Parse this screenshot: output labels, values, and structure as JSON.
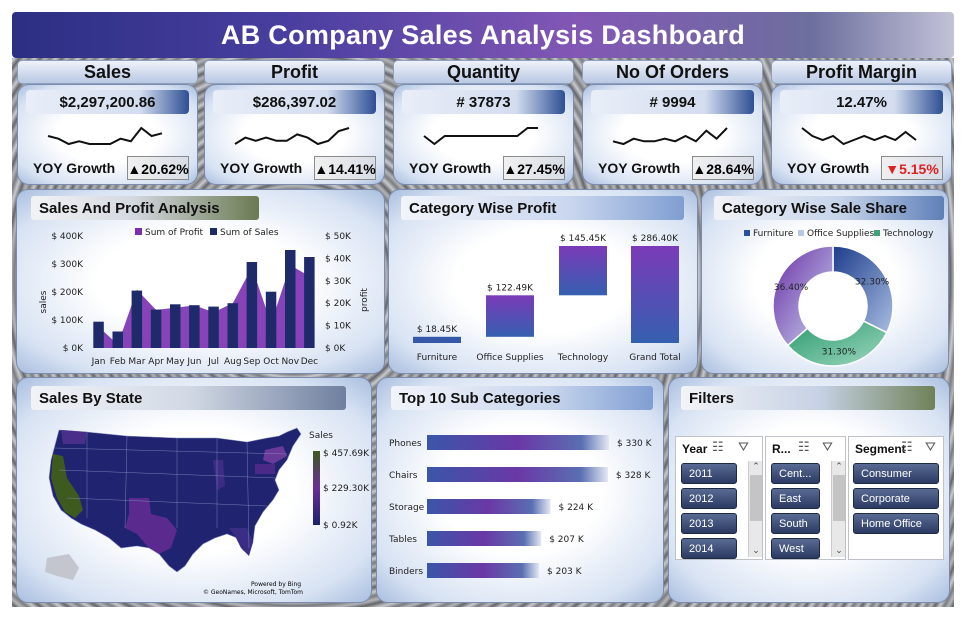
{
  "title": "AB Company Sales Analysis Dashboard",
  "kpis": [
    {
      "label": "Sales",
      "value": "$2,297,200.86",
      "yoy_label": "YOY Growth",
      "yoy": "20.62%",
      "trend": "up",
      "spark": [
        5,
        4,
        2,
        3,
        2,
        2,
        2,
        4,
        3,
        8,
        5,
        6
      ]
    },
    {
      "label": "Profit",
      "value": "$286,397.02",
      "yoy_label": "YOY Growth",
      "yoy": "14.41%",
      "trend": "up",
      "spark": [
        3,
        5,
        4,
        5,
        4,
        4,
        6,
        5,
        3,
        4,
        7,
        8
      ]
    },
    {
      "label": "Quantity",
      "value": "# 37873",
      "yoy_label": "YOY Growth",
      "yoy": "27.45%",
      "trend": "up",
      "spark": [
        4,
        3,
        4,
        4,
        4,
        4,
        4,
        4,
        4,
        4,
        5,
        5
      ]
    },
    {
      "label": "No Of Orders",
      "value": "# 9994",
      "yoy_label": "YOY Growth",
      "yoy": "28.64%",
      "trend": "up",
      "spark": [
        3,
        2,
        4,
        3,
        3,
        4,
        3,
        5,
        3,
        7,
        4,
        8
      ]
    },
    {
      "label": "Profit Margin",
      "value": "12.47%",
      "yoy_label": "YOY Growth",
      "yoy": "5.15%",
      "trend": "down",
      "spark": [
        7,
        5,
        4,
        5,
        3,
        4,
        5,
        4,
        5,
        4,
        6,
        4
      ]
    }
  ],
  "arrows": {
    "up": "▲",
    "down": "▼"
  },
  "colors": {
    "sales": "#1f2a6b",
    "profit": "#7a2fb0",
    "furniture": "#2b4fa3",
    "office": "#b7c7e6",
    "technology": "#3aa57a",
    "down": "#e02020"
  },
  "sales_profit": {
    "title": "Sales And Profit Analysis",
    "chart_data": {
      "type": "bar",
      "categories": [
        "Jan",
        "Feb",
        "Mar",
        "Apr",
        "May",
        "Jun",
        "Jul",
        "Aug",
        "Sep",
        "Oct",
        "Nov",
        "Dec"
      ],
      "series": [
        {
          "name": "Sum of Profit",
          "type": "area",
          "axis": "right",
          "values": [
            9500,
            1500,
            26000,
            17000,
            18000,
            19000,
            16000,
            20000,
            36000,
            11000,
            37000,
            32000
          ]
        },
        {
          "name": "Sum of Sales",
          "type": "bar",
          "axis": "left",
          "values": [
            94000,
            59000,
            205000,
            137000,
            156000,
            153000,
            148000,
            160000,
            307000,
            201000,
            350000,
            325000
          ]
        }
      ],
      "ylabel": "sales",
      "y2label": "profit",
      "ylim": [
        0,
        400000
      ],
      "y2lim": [
        0,
        50000
      ],
      "yticks": [
        "$ 0K",
        "$ 100K",
        "$ 200K",
        "$ 300K",
        "$ 400K"
      ],
      "y2ticks": [
        "$ 0K",
        "$ 10K",
        "$ 20K",
        "$ 30K",
        "$ 40K",
        "$ 50K"
      ],
      "legend": "top"
    }
  },
  "category_profit": {
    "title": "Category Wise Profit",
    "chart_data": {
      "type": "bar",
      "categories": [
        "Furniture",
        "Office Supplies",
        "Technology",
        "Grand Total"
      ],
      "values": [
        18.45,
        122.49,
        145.45,
        286.4
      ],
      "labels": [
        "$ 18.45K",
        "$ 122.49K",
        "$ 145.45K",
        "$ 286.40K"
      ],
      "waterfall": true
    }
  },
  "category_share": {
    "title": "Category Wise Sale Share",
    "chart_data": {
      "type": "pie",
      "categories": [
        "Furniture",
        "Office Supplies",
        "Technology"
      ],
      "values": [
        32.3,
        31.3,
        36.4
      ],
      "labels": [
        "32.30%",
        "31.30%",
        "36.40%"
      ],
      "legend": "top"
    }
  },
  "sales_state": {
    "title": "Sales By State",
    "legend_title": "Sales",
    "legend_ticks": [
      "$ 457.69K",
      "$ 229.30K",
      "$ 0.92K"
    ],
    "credit1": "Powered by Bing",
    "credit2": "© GeoNames, Microsoft, TomTom"
  },
  "top_sub": {
    "title": "Top 10 Sub Categories",
    "chart_data": {
      "type": "bar",
      "orientation": "horizontal",
      "categories": [
        "Phones",
        "Chairs",
        "Storage",
        "Tables",
        "Binders"
      ],
      "values": [
        330,
        328,
        224,
        207,
        203
      ],
      "labels": [
        "$ 330 K",
        "$ 328 K",
        "$ 224 K",
        "$ 207 K",
        "$ 203 K"
      ]
    }
  },
  "filters": {
    "title": "Filters",
    "year": {
      "title": "Year",
      "items": [
        "2011",
        "2012",
        "2013",
        "2014"
      ]
    },
    "region": {
      "title": "R...",
      "items": [
        "Cent...",
        "East",
        "South",
        "West"
      ]
    },
    "segment": {
      "title": "Segment",
      "items": [
        "Consumer",
        "Corporate",
        "Home Office"
      ]
    }
  }
}
